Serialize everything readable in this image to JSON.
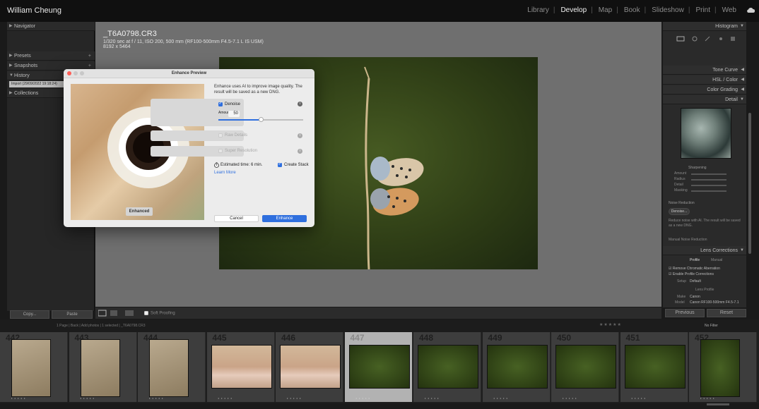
{
  "top": {
    "identity": "William Cheung",
    "modules": [
      "Library",
      "Develop",
      "Map",
      "Book",
      "Slideshow",
      "Print",
      "Web"
    ],
    "active_module": "Develop"
  },
  "left_panel": {
    "navigator": "Navigator",
    "presets": "Presets",
    "snapshots": "Snapshots",
    "history": "History",
    "history_item": "Import (29/09/2022 19:18:24)",
    "collections": "Collections",
    "copy_label": "Copy...",
    "paste_label": "Paste"
  },
  "photo_info": {
    "filename": "_T6A0798.CR3",
    "exif": "1/320 sec at f / 11, ISO 200, 500 mm (RF100-500mm F4.5-7.1 L IS USM)",
    "dimensions": "8192 x 5464"
  },
  "toolbar": {
    "soft_proofing": "Soft Proofing"
  },
  "right_panel": {
    "histogram": "Histogram",
    "tone_curve": "Tone Curve",
    "hsl": "HSL / Color",
    "color_grading": "Color Grading",
    "detail": "Detail",
    "sharpening": "Sharpening",
    "sharpen_labels": [
      "Amount",
      "Radius",
      "Detail",
      "Masking"
    ],
    "noise_reduction": "Noise Reduction",
    "denoise_btn": "Denoise...",
    "nr_note": "Reduce noise with AI. The result will be saved as a new DNG.",
    "manual_nr": "Manual Noise Reduction",
    "lens_corrections": "Lens Corrections",
    "profile_tab": "Profile",
    "manual_tab": "Manual",
    "remove_ca": "Remove Chromatic Aberration",
    "enable_profile": "Enable Profile Corrections",
    "setup_label": "Setup",
    "setup_value": "Default",
    "lens_profile": "Lens Profile",
    "make_label": "Make",
    "make_value": "Canon",
    "model_label": "Model",
    "model_value": "Canon RF100-500mm F4.5-7.1",
    "previous_label": "Previous",
    "reset_label": "Reset"
  },
  "filmstrip": {
    "path": "1 Page  |  Back  |  Add photos  |  1 selected  |  _T6A0798.CR3",
    "filter_label": "No Filter",
    "frames": [
      {
        "num": "442",
        "kind": "warm",
        "selected": false
      },
      {
        "num": "443",
        "kind": "warm",
        "selected": false
      },
      {
        "num": "444",
        "kind": "warm",
        "selected": false
      },
      {
        "num": "445",
        "kind": "hand",
        "selected": false
      },
      {
        "num": "446",
        "kind": "hand",
        "selected": false
      },
      {
        "num": "447",
        "kind": "green",
        "selected": true
      },
      {
        "num": "448",
        "kind": "green",
        "selected": false
      },
      {
        "num": "449",
        "kind": "green",
        "selected": false
      },
      {
        "num": "450",
        "kind": "green",
        "selected": false
      },
      {
        "num": "451",
        "kind": "green",
        "selected": false
      },
      {
        "num": "452",
        "kind": "green",
        "selected": false
      }
    ]
  },
  "dialog": {
    "title": "Enhance Preview",
    "enhanced_label": "Enhanced",
    "description": "Enhance uses AI to improve image quality. The result will be saved as a new DNG.",
    "denoise_label": "Denoise",
    "amount_label": "Amount",
    "amount_value": "50",
    "amount_fraction": 0.5,
    "raw_details_label": "Raw Details",
    "super_resolution_label": "Super Resolution",
    "estimated_time": "Estimated time: 6 min.",
    "create_stack_label": "Create Stack",
    "learn_more": "Learn More",
    "cancel_label": "Cancel",
    "enhance_label": "Enhance"
  },
  "colors": {
    "accent": "#2f6fde",
    "traffic_red": "#fe5f57",
    "traffic_gray": "#c8c8c8"
  }
}
